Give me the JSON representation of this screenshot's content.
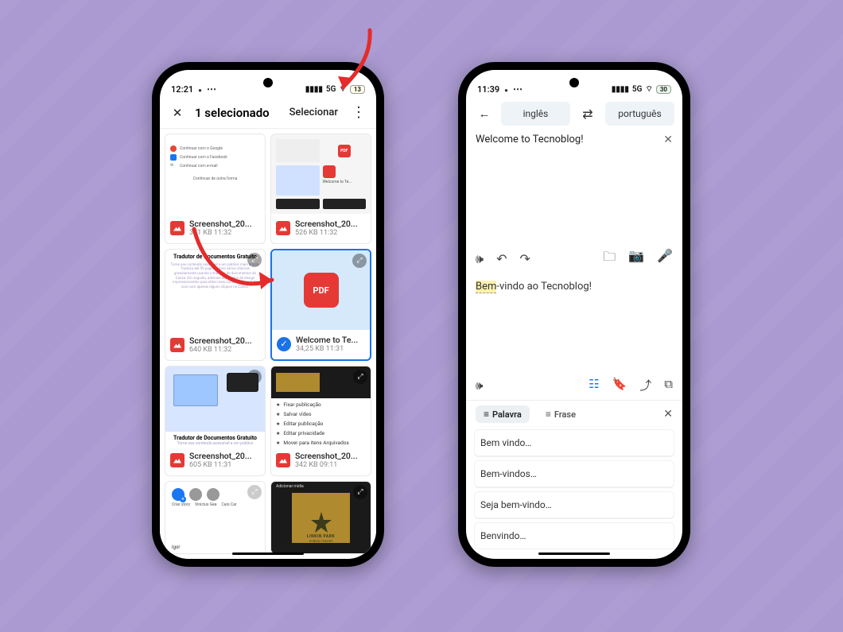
{
  "left": {
    "status": {
      "time": "12:21",
      "net": "5G",
      "battery": "13"
    },
    "appbar": {
      "title": "1 selecionado",
      "select": "Selecionar"
    },
    "tiles": [
      {
        "kind": "login-mock",
        "badge": "img",
        "name": "Screenshot_20...",
        "meta": "381 KB 11:32",
        "lines": [
          "Continuar com o Google",
          "Continuar com o Facebook",
          "Continuar com e-mail",
          "Continuar de outra forma"
        ]
      },
      {
        "kind": "pdf-thumb-small",
        "badge": "img",
        "name": "Screenshot_20...",
        "meta": "526 KB 11:32",
        "label1": "PDF",
        "label2": "Welcome to Te..."
      },
      {
        "kind": "doc-title",
        "badge": "img",
        "name": "Screenshot_20...",
        "meta": "640 KB 11:32",
        "title": "Tradutor de Documentos Gratuito",
        "para": "Torne seu conteúdo acessível a um público mais amplo. Traduza até 50 páginas para vários idiomas gratuitamente usando o tradutor de documentos do Canva. Em seguida, adicione elementos de design impressionantes para obter mais contexto. Faça tudo isso com apenas alguns cliques no Canva."
      },
      {
        "kind": "pdf-center",
        "badge": "check",
        "name": "Welcome to Te...",
        "meta": "34,25 KB 11:31",
        "selected": true,
        "pdflabel": "PDF"
      },
      {
        "kind": "canva-editor",
        "badge": "img",
        "name": "Screenshot_20...",
        "meta": "605 KB 11:31",
        "subtitle": "Tradutor de Documentos Gratuito",
        "subpara": "Torne seu conteúdo acessível a um público"
      },
      {
        "kind": "context-menu",
        "badge": "img",
        "name": "Screenshot_20...",
        "meta": "342 KB 09:11",
        "items": [
          "Fixar publicação",
          "Salvar vídeo",
          "Editar publicação",
          "Editar privacidade",
          "Mover para itens Arquivados"
        ]
      },
      {
        "kind": "feed",
        "badge": "",
        "name": "",
        "meta": "",
        "labels": [
          "Criar story",
          "Vinicius Gea",
          "Caio Car"
        ],
        "post": "Igor",
        "addlabel": "Adicionar mídia"
      },
      {
        "kind": "album-dark",
        "badge": "",
        "name": "",
        "meta": "",
        "caption1": "LINKIN PARK",
        "caption2": "HYBRID THEORY"
      }
    ]
  },
  "right": {
    "status": {
      "time": "11:39",
      "net": "5G",
      "battery": "30"
    },
    "langs": {
      "src": "inglês",
      "dst": "português"
    },
    "input": "Welcome to Tecnoblog!",
    "output_pre": "Bem",
    "output_post": "-vindo ao Tecnoblog!",
    "tabs": {
      "word": "Palavra",
      "sentence": "Frase"
    },
    "suggestions": [
      "Bem vindo…",
      "Bem-vindos…",
      "Seja bem-vindo…",
      "Benvindo…"
    ]
  }
}
